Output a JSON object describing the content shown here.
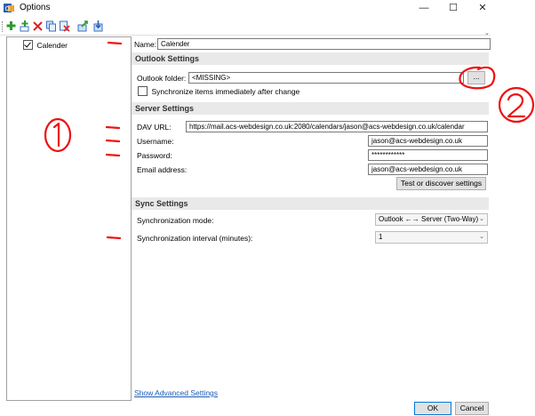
{
  "window": {
    "title": "Options",
    "minimize": "—",
    "maximize": "☐",
    "close": "✕"
  },
  "toolbar": {
    "buttons": [
      "add-icon",
      "add-multiple-icon",
      "delete-icon",
      "copy-icon",
      "clear-cache-icon",
      "export-icon",
      "import-icon"
    ],
    "overflow": "⌄"
  },
  "tree": {
    "items": [
      {
        "label": "Calender",
        "checked": true
      }
    ]
  },
  "profile": {
    "name_label": "Name:",
    "name_value": "Calender"
  },
  "outlook": {
    "header": "Outlook Settings",
    "folder_label": "Outlook folder:",
    "folder_value": "<MISSING>",
    "browse_label": "...",
    "sync_immediately_label": "Synchronize items immediately after change"
  },
  "server": {
    "header": "Server Settings",
    "dav_label": "DAV URL:",
    "dav_value": "https://mail.acs-webdesign.co.uk:2080/calendars/jason@acs-webdesign.co.uk/calendar",
    "username_label": "Username:",
    "username_value": "jason@acs-webdesign.co.uk",
    "password_label": "Password:",
    "password_value": "************",
    "email_label": "Email address:",
    "email_value": "jason@acs-webdesign.co.uk",
    "test_button": "Test or discover settings"
  },
  "sync": {
    "header": "Sync Settings",
    "mode_label": "Synchronization mode:",
    "mode_value": "Outlook ←→ Server (Two-Way)",
    "interval_label": "Synchronization interval (minutes):",
    "interval_value": "1"
  },
  "footer": {
    "advanced_link": "Show Advanced Settings",
    "ok": "OK",
    "cancel": "Cancel"
  },
  "annotations": {
    "circle_one": "1",
    "circle_two": "2",
    "color": "#e11111"
  }
}
